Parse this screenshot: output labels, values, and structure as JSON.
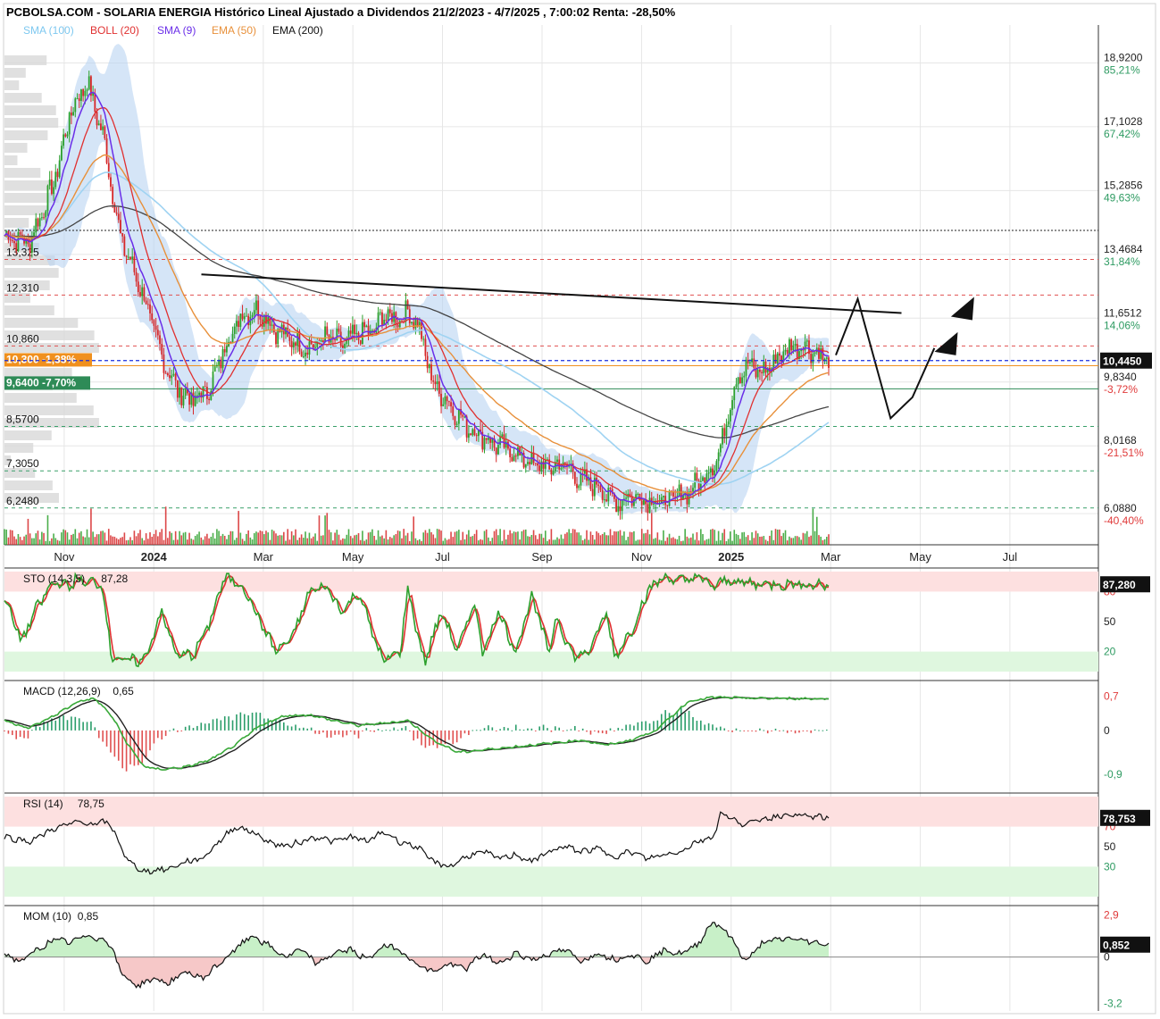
{
  "header": {
    "title": "PCBOLSA.COM - SOLARIA ENERGIA Histórico Lineal Ajustado a Dividendos 21/2/2023 - 4/7/2025 , 7:00:02 Renta: -28,50%",
    "legend": [
      {
        "label": "SMA (100)",
        "color": "#7ec8f0"
      },
      {
        "label": "BOLL (20)",
        "color": "#e03030"
      },
      {
        "label": "SMA (9)",
        "color": "#6a2ee8"
      },
      {
        "label": "EMA (50)",
        "color": "#e8903a"
      },
      {
        "label": "EMA (200)",
        "color": "#111111"
      }
    ]
  },
  "colors": {
    "up": "#2ca02c",
    "down": "#d62728",
    "boll_band": "#b9d3f2",
    "sma100": "#9fd3f2",
    "ema200": "#444444",
    "sma9": "#6a2ee8",
    "ema50": "#e8903a",
    "boll_mid": "#e03030",
    "overbought_zone": "#fde0e0",
    "oversold_zone": "#dff7df",
    "green_label": "#2e8b57",
    "orange_label": "#f0901e",
    "drawing": "#111111"
  },
  "chart_data": [
    {
      "type": "line",
      "panel": "price",
      "ylim": [
        5.2,
        20.0
      ],
      "x_ticks": [
        "Nov",
        "2024",
        "Mar",
        "May",
        "Jul",
        "Sep",
        "Nov",
        "2025",
        "Mar",
        "May",
        "Jul"
      ],
      "x_ticks_bold": [
        "2024",
        "2025"
      ],
      "x_tick_pos": [
        0.03,
        0.075,
        0.13,
        0.175,
        0.22,
        0.27,
        0.32,
        0.365,
        0.415,
        0.46,
        0.505
      ],
      "right_axis": [
        {
          "price": 18.92,
          "label": "18,9200",
          "pct": "85,21%"
        },
        {
          "price": 17.1028,
          "label": "17,1028",
          "pct": "67,42%"
        },
        {
          "price": 15.2856,
          "label": "15,2856",
          "pct": "49,63%"
        },
        {
          "price": 13.4684,
          "label": "13,4684",
          "pct": "31,84%"
        },
        {
          "price": 11.6512,
          "label": "11,6512",
          "pct": "14,06%"
        },
        {
          "price": 9.834,
          "label": "9,8340",
          "pct": "-3,72%"
        },
        {
          "price": 8.0168,
          "label": "8,0168",
          "pct": "-21,51%"
        },
        {
          "price": 6.088,
          "label": "6,0880",
          "pct": "-40,40%"
        }
      ],
      "last_price": {
        "value": 10.445,
        "label": "10,4450"
      },
      "hlines": [
        {
          "price": 13.325,
          "label": "13,325",
          "style": "red-dashed"
        },
        {
          "price": 12.31,
          "label": "12,310",
          "style": "red-dashed"
        },
        {
          "price": 10.86,
          "label": "10,860",
          "style": "red-dashed"
        },
        {
          "price": 10.3,
          "label": "10,300 -1,38%",
          "style": "orange-solid"
        },
        {
          "price": 9.64,
          "label": "9,6400 -7,70%",
          "style": "green-solid"
        },
        {
          "price": 8.57,
          "label": "8,5700",
          "style": "green-dashed"
        },
        {
          "price": 7.305,
          "label": "7,3050",
          "style": "green-dashed"
        },
        {
          "price": 6.248,
          "label": "6,2480",
          "style": "green-dashed"
        }
      ],
      "dotted_line": 14.15,
      "close_anchors": [
        [
          0.0,
          14.0
        ],
        [
          0.03,
          13.8
        ],
        [
          0.06,
          15.5
        ],
        [
          0.08,
          17.5
        ],
        [
          0.1,
          18.4
        ],
        [
          0.12,
          16.8
        ],
        [
          0.14,
          14.0
        ],
        [
          0.17,
          12.2
        ],
        [
          0.19,
          10.6
        ],
        [
          0.21,
          9.6
        ],
        [
          0.23,
          9.3
        ],
        [
          0.25,
          9.7
        ],
        [
          0.27,
          11.0
        ],
        [
          0.29,
          11.8
        ],
        [
          0.31,
          11.9
        ],
        [
          0.33,
          11.3
        ],
        [
          0.35,
          11.0
        ],
        [
          0.37,
          10.8
        ],
        [
          0.39,
          11.1
        ],
        [
          0.41,
          10.9
        ],
        [
          0.43,
          11.2
        ],
        [
          0.45,
          11.3
        ],
        [
          0.46,
          11.8
        ],
        [
          0.47,
          11.6
        ],
        [
          0.49,
          11.8
        ],
        [
          0.5,
          11.6
        ],
        [
          0.52,
          9.8
        ],
        [
          0.54,
          9.2
        ],
        [
          0.56,
          8.6
        ],
        [
          0.58,
          8.3
        ],
        [
          0.6,
          8.0
        ],
        [
          0.62,
          7.8
        ],
        [
          0.64,
          7.5
        ],
        [
          0.66,
          7.4
        ],
        [
          0.68,
          7.5
        ],
        [
          0.7,
          7.0
        ],
        [
          0.72,
          6.9
        ],
        [
          0.74,
          6.4
        ],
        [
          0.76,
          6.6
        ],
        [
          0.78,
          6.5
        ],
        [
          0.8,
          6.4
        ],
        [
          0.82,
          6.6
        ],
        [
          0.84,
          6.9
        ],
        [
          0.86,
          7.5
        ],
        [
          0.87,
          8.0
        ],
        [
          0.88,
          9.3
        ],
        [
          0.89,
          10.0
        ],
        [
          0.9,
          10.3
        ],
        [
          0.92,
          10.1
        ],
        [
          0.95,
          10.8
        ],
        [
          0.97,
          10.9
        ],
        [
          1.0,
          10.45
        ]
      ],
      "drawn_lines": {
        "trendline": [
          [
            0.18,
            12.9
          ],
          [
            0.82,
            11.8
          ]
        ],
        "zigzag": [
          [
            0.76,
            10.6
          ],
          [
            0.78,
            12.2
          ],
          [
            0.81,
            8.8
          ],
          [
            0.83,
            9.4
          ],
          [
            0.85,
            10.8
          ]
        ],
        "arrows": [
          [
            0.86,
            10.9
          ],
          [
            0.875,
            11.9
          ]
        ]
      }
    },
    {
      "type": "line",
      "panel": "sto",
      "name": "STO (14,3,5)",
      "value_label": "87,28",
      "ylim": [
        0,
        100
      ],
      "levels": [
        {
          "value": 80,
          "label": "80"
        },
        {
          "value": 50,
          "label": "50"
        },
        {
          "value": 20,
          "label": "20"
        }
      ],
      "last_value": {
        "value": 87.28,
        "label": "87,280"
      },
      "anchors": [
        [
          0.0,
          75
        ],
        [
          0.02,
          30
        ],
        [
          0.04,
          65
        ],
        [
          0.06,
          90
        ],
        [
          0.08,
          85
        ],
        [
          0.09,
          95
        ],
        [
          0.1,
          85
        ],
        [
          0.11,
          93
        ],
        [
          0.12,
          80
        ],
        [
          0.13,
          15
        ],
        [
          0.15,
          10
        ],
        [
          0.17,
          12
        ],
        [
          0.19,
          60
        ],
        [
          0.21,
          15
        ],
        [
          0.23,
          18
        ],
        [
          0.25,
          50
        ],
        [
          0.26,
          80
        ],
        [
          0.27,
          95
        ],
        [
          0.29,
          85
        ],
        [
          0.31,
          50
        ],
        [
          0.33,
          20
        ],
        [
          0.35,
          35
        ],
        [
          0.37,
          80
        ],
        [
          0.39,
          85
        ],
        [
          0.41,
          60
        ],
        [
          0.43,
          80
        ],
        [
          0.45,
          30
        ],
        [
          0.46,
          10
        ],
        [
          0.48,
          20
        ],
        [
          0.49,
          85
        ],
        [
          0.5,
          40
        ],
        [
          0.51,
          10
        ],
        [
          0.53,
          60
        ],
        [
          0.55,
          20
        ],
        [
          0.57,
          70
        ],
        [
          0.58,
          20
        ],
        [
          0.6,
          60
        ],
        [
          0.62,
          20
        ],
        [
          0.64,
          75
        ],
        [
          0.66,
          20
        ],
        [
          0.67,
          55
        ],
        [
          0.69,
          15
        ],
        [
          0.71,
          20
        ],
        [
          0.73,
          60
        ],
        [
          0.74,
          15
        ],
        [
          0.76,
          40
        ],
        [
          0.78,
          80
        ],
        [
          0.8,
          95
        ],
        [
          0.82,
          90
        ],
        [
          0.84,
          95
        ],
        [
          0.86,
          85
        ],
        [
          0.88,
          92
        ],
        [
          0.9,
          88
        ],
        [
          1.0,
          87
        ]
      ]
    },
    {
      "type": "area",
      "panel": "macd",
      "name": "MACD (12,26,9)",
      "value_label": "0,65",
      "ylim": [
        -1.1,
        0.95
      ],
      "levels": [
        {
          "value": 0.7,
          "label": "0,7"
        },
        {
          "value": 0,
          "label": "0"
        },
        {
          "value": -0.9,
          "label": "-0,9"
        }
      ],
      "anchors": [
        [
          0.0,
          0.2
        ],
        [
          0.03,
          0.05
        ],
        [
          0.06,
          0.3
        ],
        [
          0.09,
          0.6
        ],
        [
          0.11,
          0.65
        ],
        [
          0.13,
          0.3
        ],
        [
          0.15,
          -0.3
        ],
        [
          0.17,
          -0.75
        ],
        [
          0.19,
          -0.8
        ],
        [
          0.22,
          -0.75
        ],
        [
          0.25,
          -0.6
        ],
        [
          0.28,
          -0.3
        ],
        [
          0.31,
          0.1
        ],
        [
          0.34,
          0.3
        ],
        [
          0.37,
          0.32
        ],
        [
          0.4,
          0.2
        ],
        [
          0.43,
          0.1
        ],
        [
          0.46,
          0.15
        ],
        [
          0.49,
          0.2
        ],
        [
          0.52,
          -0.2
        ],
        [
          0.55,
          -0.45
        ],
        [
          0.58,
          -0.4
        ],
        [
          0.61,
          -0.35
        ],
        [
          0.64,
          -0.3
        ],
        [
          0.67,
          -0.25
        ],
        [
          0.7,
          -0.2
        ],
        [
          0.73,
          -0.3
        ],
        [
          0.76,
          -0.2
        ],
        [
          0.79,
          0.0
        ],
        [
          0.81,
          0.3
        ],
        [
          0.83,
          0.6
        ],
        [
          0.86,
          0.68
        ],
        [
          0.9,
          0.66
        ],
        [
          1.0,
          0.65
        ]
      ]
    },
    {
      "type": "line",
      "panel": "rsi",
      "name": "RSI (14)",
      "value_label": "78,75",
      "ylim": [
        0,
        100
      ],
      "levels": [
        {
          "value": 70,
          "label": "70"
        },
        {
          "value": 50,
          "label": "50"
        },
        {
          "value": 30,
          "label": "30"
        }
      ],
      "last_value": {
        "value": 78.753,
        "label": "78,753"
      },
      "anchors": [
        [
          0.0,
          60
        ],
        [
          0.03,
          55
        ],
        [
          0.06,
          68
        ],
        [
          0.09,
          75
        ],
        [
          0.11,
          72
        ],
        [
          0.12,
          75
        ],
        [
          0.13,
          70
        ],
        [
          0.15,
          35
        ],
        [
          0.17,
          25
        ],
        [
          0.2,
          28
        ],
        [
          0.22,
          35
        ],
        [
          0.24,
          38
        ],
        [
          0.26,
          55
        ],
        [
          0.28,
          70
        ],
        [
          0.3,
          65
        ],
        [
          0.32,
          55
        ],
        [
          0.34,
          50
        ],
        [
          0.36,
          55
        ],
        [
          0.38,
          60
        ],
        [
          0.4,
          55
        ],
        [
          0.42,
          60
        ],
        [
          0.44,
          55
        ],
        [
          0.46,
          65
        ],
        [
          0.48,
          55
        ],
        [
          0.5,
          50
        ],
        [
          0.52,
          35
        ],
        [
          0.54,
          30
        ],
        [
          0.56,
          40
        ],
        [
          0.58,
          45
        ],
        [
          0.6,
          38
        ],
        [
          0.62,
          42
        ],
        [
          0.64,
          35
        ],
        [
          0.66,
          45
        ],
        [
          0.68,
          50
        ],
        [
          0.7,
          45
        ],
        [
          0.72,
          48
        ],
        [
          0.74,
          40
        ],
        [
          0.76,
          45
        ],
        [
          0.78,
          38
        ],
        [
          0.8,
          42
        ],
        [
          0.82,
          45
        ],
        [
          0.84,
          55
        ],
        [
          0.86,
          60
        ],
        [
          0.87,
          85
        ],
        [
          0.88,
          78
        ],
        [
          0.9,
          72
        ],
        [
          0.92,
          78
        ],
        [
          0.95,
          82
        ],
        [
          1.0,
          78.75
        ]
      ]
    },
    {
      "type": "area",
      "panel": "mom",
      "name": "MOM (10)",
      "value_label": "0,85",
      "ylim": [
        -3.6,
        3.3
      ],
      "levels": [
        {
          "value": 2.9,
          "label": "2,9"
        },
        {
          "value": 0,
          "label": "0"
        },
        {
          "value": -3.2,
          "label": "-3,2"
        }
      ],
      "last_value": {
        "value": 0.852,
        "label": "0,852"
      },
      "anchors": [
        [
          0.0,
          0.2
        ],
        [
          0.02,
          -0.3
        ],
        [
          0.04,
          0.5
        ],
        [
          0.06,
          1.2
        ],
        [
          0.08,
          1.0
        ],
        [
          0.1,
          1.5
        ],
        [
          0.12,
          1.2
        ],
        [
          0.13,
          0.8
        ],
        [
          0.14,
          -1.0
        ],
        [
          0.16,
          -2.0
        ],
        [
          0.18,
          -1.5
        ],
        [
          0.2,
          -1.8
        ],
        [
          0.22,
          -1.0
        ],
        [
          0.24,
          -1.5
        ],
        [
          0.26,
          -0.5
        ],
        [
          0.28,
          0.5
        ],
        [
          0.3,
          1.5
        ],
        [
          0.32,
          0.8
        ],
        [
          0.34,
          0.0
        ],
        [
          0.36,
          0.5
        ],
        [
          0.38,
          -0.5
        ],
        [
          0.4,
          0.3
        ],
        [
          0.42,
          0.5
        ],
        [
          0.44,
          -0.2
        ],
        [
          0.46,
          0.8
        ],
        [
          0.48,
          0.5
        ],
        [
          0.5,
          -0.5
        ],
        [
          0.52,
          -1.0
        ],
        [
          0.54,
          -0.5
        ],
        [
          0.56,
          -0.8
        ],
        [
          0.58,
          0.2
        ],
        [
          0.6,
          -0.5
        ],
        [
          0.62,
          0.3
        ],
        [
          0.64,
          -0.2
        ],
        [
          0.66,
          0.2
        ],
        [
          0.68,
          0.5
        ],
        [
          0.7,
          -0.3
        ],
        [
          0.72,
          0.3
        ],
        [
          0.74,
          -0.2
        ],
        [
          0.76,
          0.2
        ],
        [
          0.78,
          -0.3
        ],
        [
          0.8,
          0.5
        ],
        [
          0.82,
          0.2
        ],
        [
          0.84,
          0.8
        ],
        [
          0.86,
          2.5
        ],
        [
          0.87,
          2.0
        ],
        [
          0.88,
          1.5
        ],
        [
          0.89,
          0.5
        ],
        [
          0.9,
          -0.3
        ],
        [
          0.92,
          1.0
        ],
        [
          0.95,
          1.3
        ],
        [
          1.0,
          0.85
        ]
      ]
    }
  ]
}
